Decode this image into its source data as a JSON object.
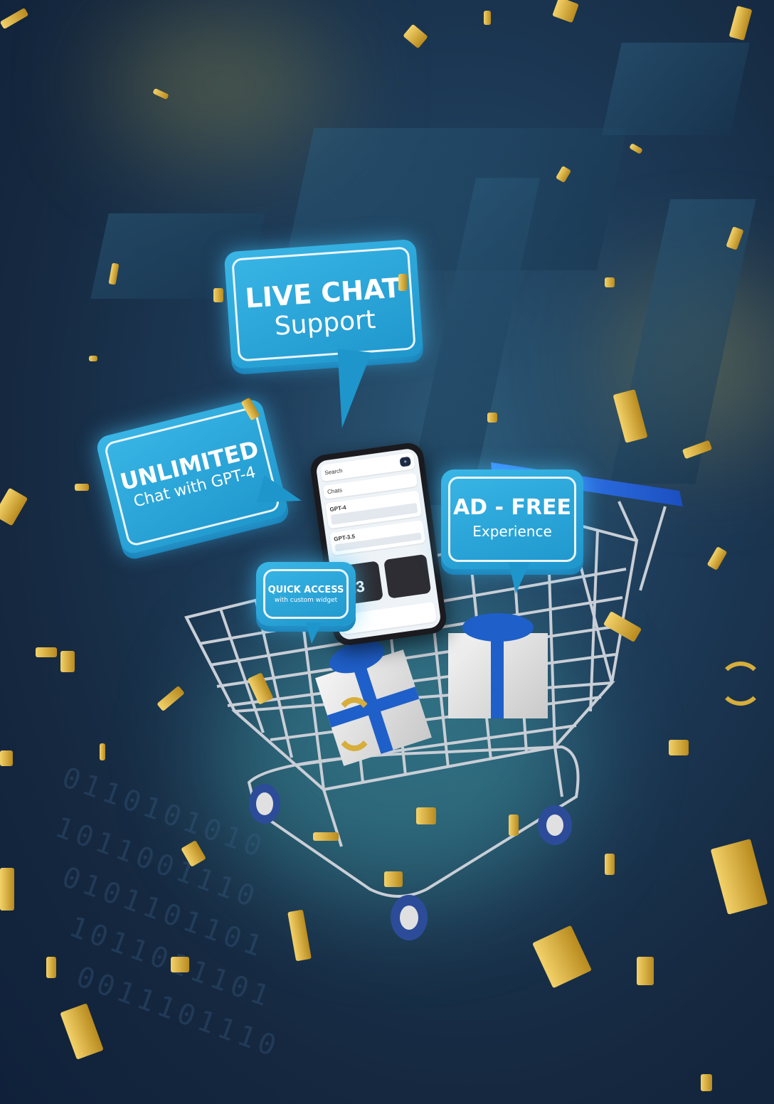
{
  "bubbles": {
    "live_chat": {
      "title": "LIVE CHAT",
      "subtitle": "Support"
    },
    "unlimited": {
      "title": "UNLIMITED",
      "subtitle": "Chat with GPT-4"
    },
    "ad_free": {
      "title": "AD - FREE",
      "subtitle": "Experience"
    },
    "quick_access": {
      "title": "QUICK ACCESS",
      "subtitle": "with custom widget"
    }
  },
  "phone": {
    "search_label": "Search",
    "section_label": "Chats",
    "items": [
      "GPT-4",
      "GPT-3.5"
    ],
    "widget_number": "23"
  },
  "binary_rows": [
    "0110101010",
    "1011001110",
    "0101101101",
    "1011011101",
    "0011101110"
  ],
  "colors": {
    "bubble_blue": "#2aa8dc",
    "confetti_gold": "#e3b945",
    "ribbon_blue": "#1f5fc9",
    "background_navy": "#15283f"
  }
}
